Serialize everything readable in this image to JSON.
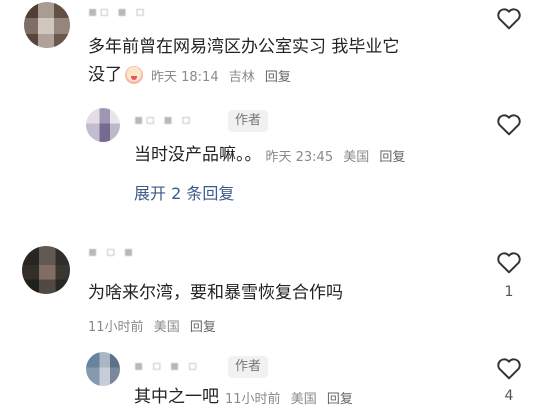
{
  "comments": [
    {
      "username": "▪▫ ▪ ▫",
      "text_line1": "多年前曾在网易湾区办公室实习 我毕业它",
      "text_line2": "没了",
      "emoji": "crying-face-emoji",
      "time": "昨天 18:14",
      "location": "吉林",
      "reply_label": "回复",
      "likes": ""
    },
    {
      "username": "▪▫ ▪ ▫",
      "author_tag": "作者",
      "text": "当时没产品嘛。。",
      "time": "昨天 23:45",
      "location": "美国",
      "reply_label": "回复",
      "likes": ""
    },
    {
      "expand_label": "展开 2 条回复"
    },
    {
      "username": "▪ ▫ ▪",
      "text": "为啥来尔湾，要和暴雪恢复合作吗",
      "time": "11小时前",
      "location": "美国",
      "reply_label": "回复",
      "likes": "1"
    },
    {
      "username": "▪ ▫ ▪ ▫",
      "author_tag": "作者",
      "text": "其中之一吧",
      "time": "11小时前",
      "location": "美国",
      "reply_label": "回复",
      "likes": "4"
    }
  ],
  "colors": {
    "text": "#222222",
    "meta": "#8a8a8a",
    "link": "#3d5a8c",
    "tag_bg": "#f1f1f1"
  },
  "icons": {
    "like": "heart-outline-icon"
  }
}
